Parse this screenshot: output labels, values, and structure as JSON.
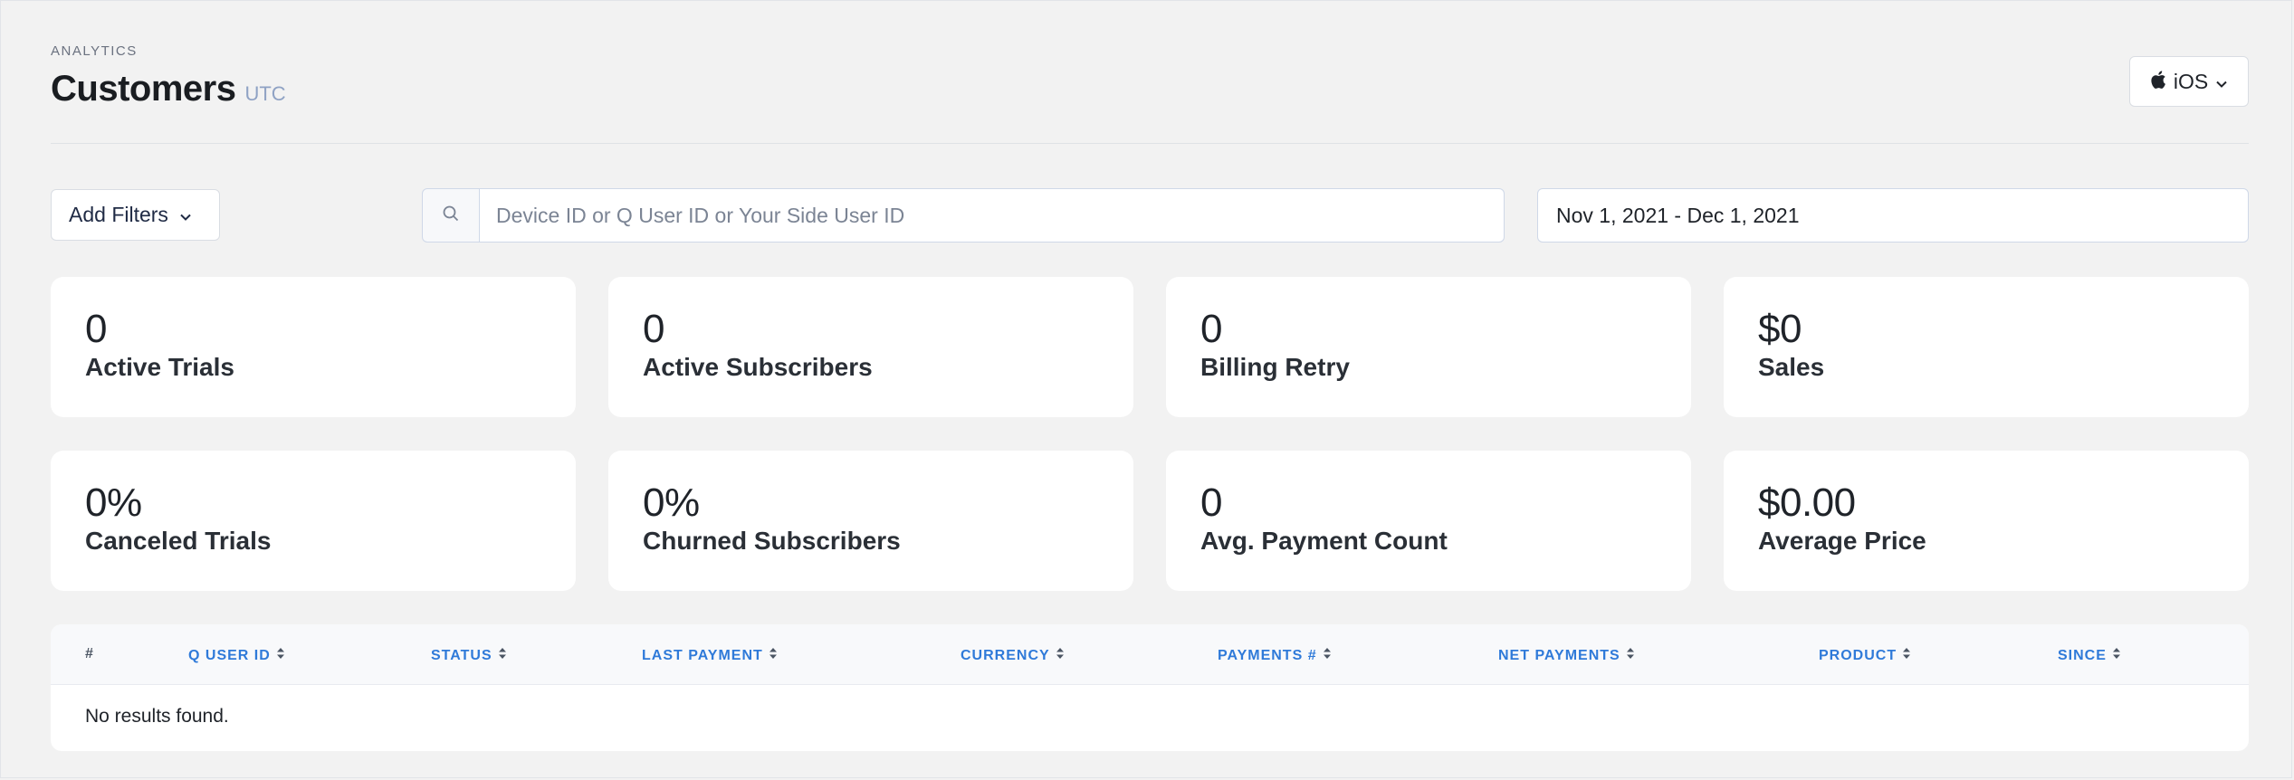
{
  "header": {
    "eyebrow": "ANALYTICS",
    "title": "Customers",
    "timezone": "UTC",
    "platform_label": "iOS",
    "platform_icon": "apple-icon"
  },
  "toolbar": {
    "filters_label": "Add Filters",
    "search_placeholder": "Device ID or Q User ID or Your Side User ID",
    "search_value": "",
    "date_range": "Nov 1, 2021 - Dec 1, 2021"
  },
  "metrics": [
    {
      "value": "0",
      "label": "Active Trials"
    },
    {
      "value": "0",
      "label": "Active Subscribers"
    },
    {
      "value": "0",
      "label": "Billing Retry"
    },
    {
      "value": "$0",
      "label": "Sales"
    },
    {
      "value": "0%",
      "label": "Canceled Trials"
    },
    {
      "value": "0%",
      "label": "Churned Subscribers"
    },
    {
      "value": "0",
      "label": "Avg. Payment Count"
    },
    {
      "value": "$0.00",
      "label": "Average Price"
    }
  ],
  "table": {
    "columns": [
      "#",
      "Q USER ID",
      "STATUS",
      "LAST PAYMENT",
      "CURRENCY",
      "PAYMENTS #",
      "NET PAYMENTS",
      "PRODUCT",
      "SINCE"
    ],
    "empty_message": "No results found."
  },
  "colors": {
    "accent": "#2f7ad9",
    "background": "#f2f2f2",
    "timezone_label": "#8fa2c4"
  }
}
